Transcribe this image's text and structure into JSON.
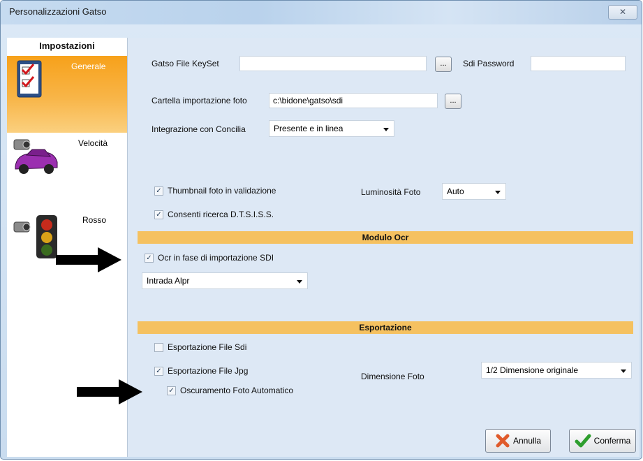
{
  "window": {
    "title": "Personalizzazioni Gatso",
    "close_glyph": "✕"
  },
  "sidebar": {
    "header": "Impostazioni",
    "items": [
      {
        "label": "Generale",
        "icon": "checklist-icon",
        "active": true
      },
      {
        "label": "Velocità",
        "icon": "speed-camera-car-icon",
        "active": false
      },
      {
        "label": "Rosso",
        "icon": "traffic-light-camera-icon",
        "active": false
      }
    ]
  },
  "general": {
    "keyset_label": "Gatso File KeySet",
    "keyset_value": "",
    "browse_label": "...",
    "sdi_password_label": "Sdi Password",
    "sdi_password_value": "",
    "import_folder_label": "Cartella importazione foto",
    "import_folder_value": "c:\\bidone\\gatso\\sdi",
    "concilia_label": "Integrazione con Concilia",
    "concilia_value": "Presente e in linea",
    "thumbnail_label": "Thumbnail foto in validazione",
    "thumbnail_checked": true,
    "brightness_label": "Luminosità Foto",
    "brightness_value": "Auto",
    "dtsiss_label": "Consenti ricerca D.T.S.I.S.S.",
    "dtsiss_checked": true
  },
  "ocr": {
    "section_title": "Modulo Ocr",
    "ocr_import_label": "Ocr in fase di importazione SDI",
    "ocr_import_checked": true,
    "engine_value": "Intrada Alpr"
  },
  "export": {
    "section_title": "Esportazione",
    "sdi_label": "Esportazione File Sdi",
    "sdi_checked": false,
    "jpg_label": "Esportazione File Jpg",
    "jpg_checked": true,
    "photo_size_label": "Dimensione Foto",
    "photo_size_value": "1/2 Dimensione originale",
    "blur_label": "Oscuramento Foto Automatico",
    "blur_checked": true
  },
  "buttons": {
    "cancel": "Annulla",
    "confirm": "Conferma"
  },
  "colors": {
    "active_sidebar": "#f7a11a",
    "section_band": "#f5c160",
    "cancel_icon": "#e05a2a",
    "confirm_icon": "#2e9e2e"
  }
}
